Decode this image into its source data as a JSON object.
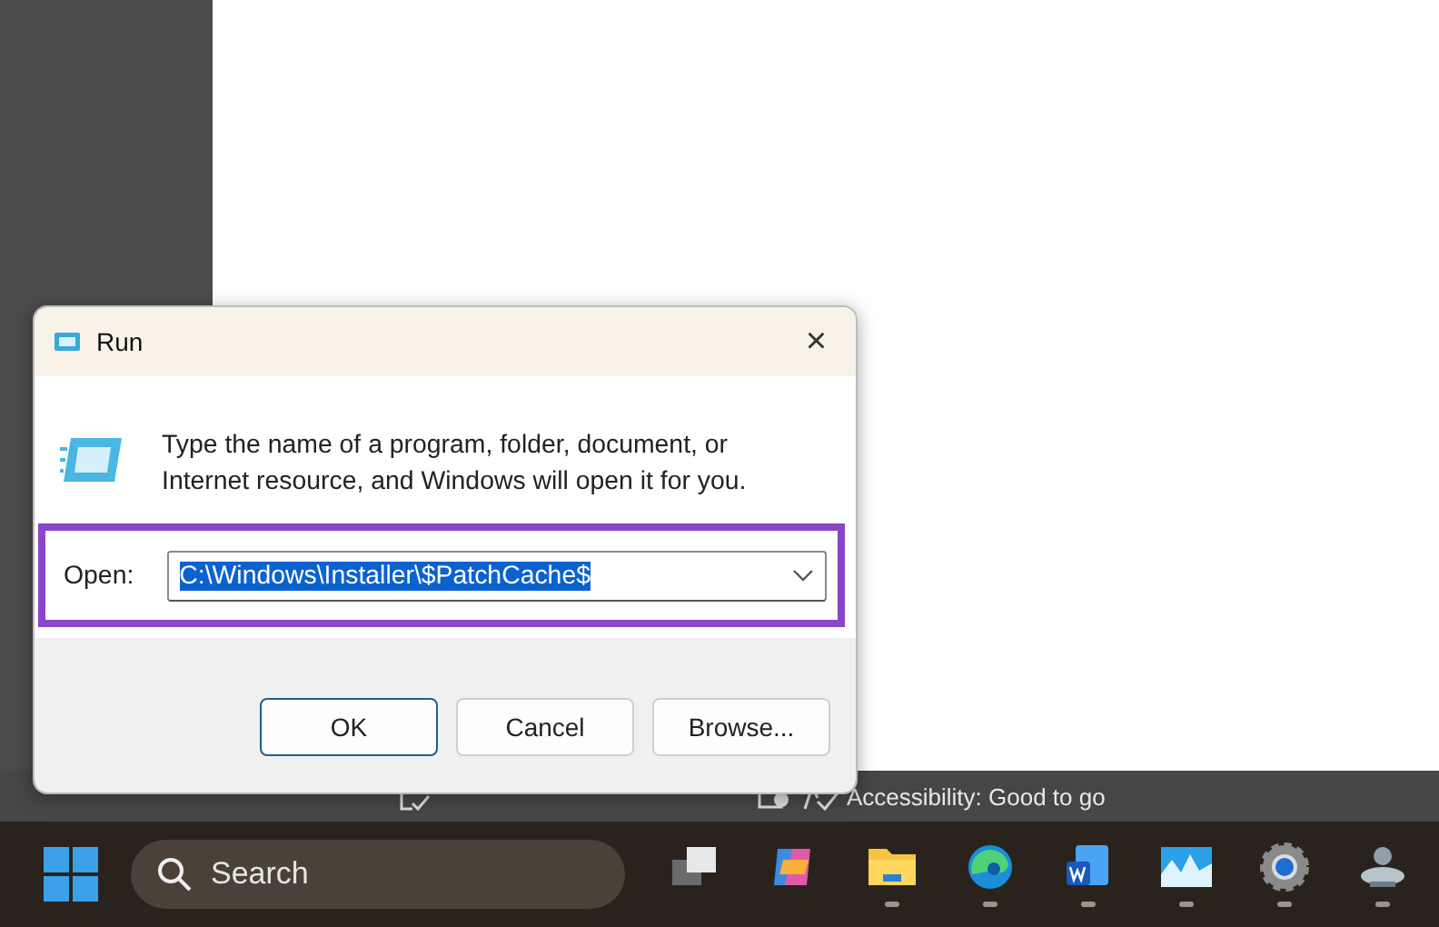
{
  "status_bar": {
    "items": [
      {
        "kind": "proofing"
      },
      {
        "kind": "focus"
      },
      {
        "kind": "accessibility",
        "text": "Accessibility: Good to go"
      }
    ]
  },
  "dialog": {
    "title": "Run",
    "close": "×",
    "description": "Type the name of a program, folder, document, or Internet resource, and Windows will open it for you.",
    "open_label": "Open:",
    "open_value": "C:\\Windows\\Installer\\$PatchCache$",
    "buttons": [
      {
        "label": "OK",
        "default": true
      },
      {
        "label": "Cancel",
        "default": false
      },
      {
        "label": "Browse...",
        "default": false
      }
    ]
  },
  "taskbar": {
    "search": {
      "placeholder": "Search"
    },
    "apps": [
      {
        "kind": "taskview",
        "running": false
      },
      {
        "kind": "copilot",
        "running": false
      },
      {
        "kind": "files",
        "running": true
      },
      {
        "kind": "edge",
        "running": true
      },
      {
        "kind": "word",
        "running": true
      },
      {
        "kind": "monitor",
        "running": true
      },
      {
        "kind": "settings",
        "running": true
      },
      {
        "kind": "network",
        "running": true
      }
    ]
  }
}
